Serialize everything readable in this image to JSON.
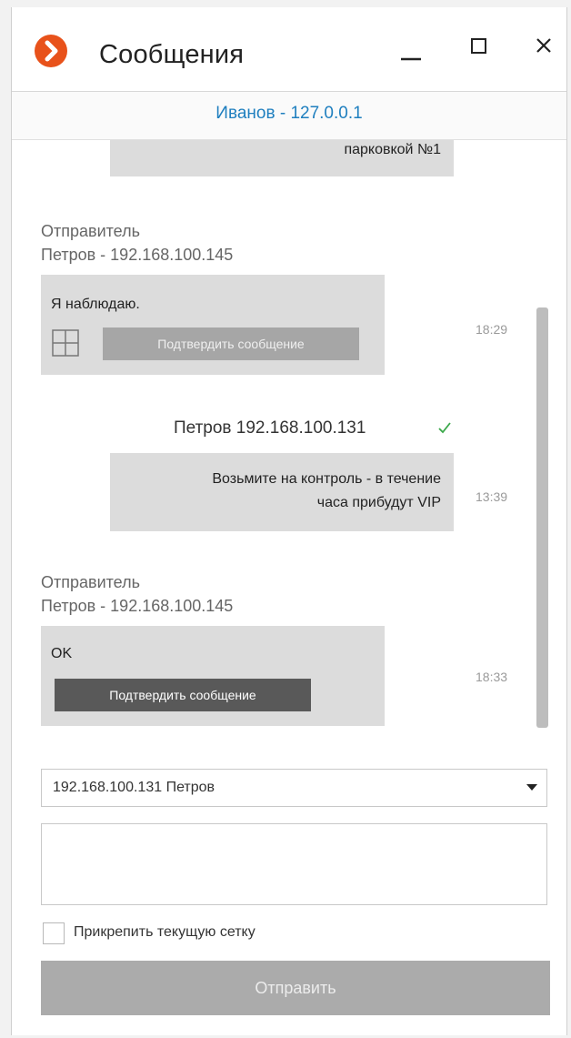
{
  "window": {
    "title": "Сообщения",
    "accent_color": "#e8521b",
    "controls": {
      "minimize": "minimize-icon",
      "maximize": "maximize-icon",
      "close": "close-icon"
    }
  },
  "contact": {
    "name": "Иванов - 127.0.0.1",
    "color": "#1f7fbf"
  },
  "messages": [
    {
      "type": "outgoing-partial",
      "text": "парковкой №1"
    },
    {
      "type": "incoming",
      "sender_prefix": "Отправитель",
      "sender": "Петров - 192.168.100.145",
      "text": "Я наблюдаю.",
      "attachment_icon": "grid-layout-icon",
      "confirm_label": "Подтвердить сообщение",
      "confirm_enabled": false,
      "time": "18:29"
    },
    {
      "type": "outgoing",
      "recipient": "Петров 192.168.100.131",
      "status_icon": "checkmark-icon",
      "text_line1": "Возьмите на контроль - в течение",
      "text_line2": "часа прибудут VIP",
      "time": "13:39"
    },
    {
      "type": "incoming",
      "sender_prefix": "Отправитель",
      "sender": "Петров - 192.168.100.145",
      "text": "OK",
      "confirm_label": "Подтвердить сообщение",
      "confirm_enabled": true,
      "time": "18:33"
    }
  ],
  "composer": {
    "recipient_selected": "192.168.100.131 Петров",
    "message_value": "",
    "attach_grid_label": "Прикрепить текущую сетку",
    "attach_grid_checked": false,
    "send_label": "Отправить"
  }
}
